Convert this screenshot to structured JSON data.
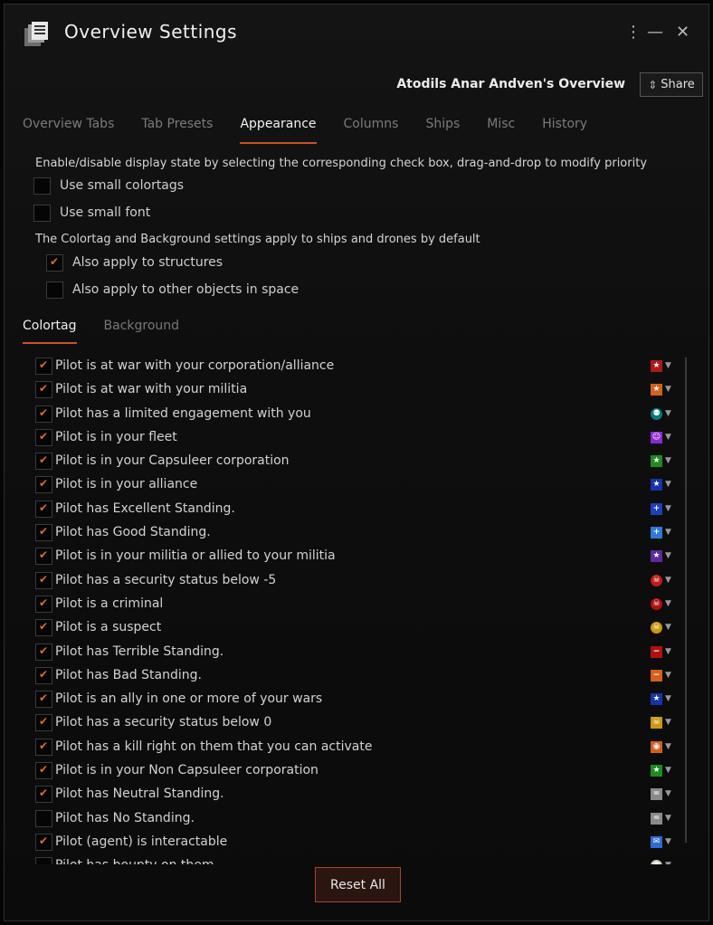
{
  "window": {
    "title": "Overview Settings",
    "owner": "Atodils Anar Andven's Overview",
    "share_label": "Share",
    "menu_icon": "⋮",
    "minimize_icon": "—",
    "close_icon": "✕"
  },
  "tabs": [
    {
      "label": "Overview Tabs",
      "active": false
    },
    {
      "label": "Tab Presets",
      "active": false
    },
    {
      "label": "Appearance",
      "active": true
    },
    {
      "label": "Columns",
      "active": false
    },
    {
      "label": "Ships",
      "active": false
    },
    {
      "label": "Misc",
      "active": false
    },
    {
      "label": "History",
      "active": false
    }
  ],
  "appearance": {
    "intro": "Enable/disable display state by selecting the corresponding check box, drag-and-drop to modify priority",
    "small_colortags": {
      "label": "Use small colortags",
      "checked": false
    },
    "small_font": {
      "label": "Use small font",
      "checked": false
    },
    "apply_note": "The Colortag and Background settings apply to ships and drones by default",
    "apply_structures": {
      "label": "Also apply to structures",
      "checked": true
    },
    "apply_other": {
      "label": "Also apply to other objects in space",
      "checked": false
    }
  },
  "subtabs": [
    {
      "label": "Colortag",
      "active": true
    },
    {
      "label": "Background",
      "active": false
    }
  ],
  "colortags": [
    {
      "label": "Pilot is at war with your corporation/alliance",
      "checked": true,
      "color": "#b01818",
      "symbol": "★",
      "round": false
    },
    {
      "label": "Pilot is at war with your militia",
      "checked": true,
      "color": "#d4601c",
      "symbol": "★",
      "round": false
    },
    {
      "label": "Pilot has a limited engagement with you",
      "checked": true,
      "color": "#0a7a7a",
      "symbol": "⚉",
      "round": true
    },
    {
      "label": "Pilot is in your fleet",
      "checked": true,
      "color": "#8a2bd0",
      "symbol": "☺",
      "round": false
    },
    {
      "label": "Pilot is in your Capsuleer corporation",
      "checked": true,
      "color": "#1f8a22",
      "symbol": "★",
      "round": false
    },
    {
      "label": "Pilot is in your alliance",
      "checked": true,
      "color": "#1633a8",
      "symbol": "★",
      "round": false
    },
    {
      "label": "Pilot has Excellent Standing.",
      "checked": true,
      "color": "#1d3fb8",
      "symbol": "+",
      "round": false
    },
    {
      "label": "Pilot has Good Standing.",
      "checked": true,
      "color": "#2e7ad8",
      "symbol": "+",
      "round": false
    },
    {
      "label": "Pilot is in your militia or allied to your militia",
      "checked": true,
      "color": "#5a2aa0",
      "symbol": "★",
      "round": false
    },
    {
      "label": "Pilot has a security status below -5",
      "checked": true,
      "color": "#c01a1a",
      "symbol": "☠",
      "round": true
    },
    {
      "label": "Pilot is a criminal",
      "checked": true,
      "color": "#b01010",
      "symbol": "☠",
      "round": true
    },
    {
      "label": "Pilot is a suspect",
      "checked": true,
      "color": "#c99a10",
      "symbol": "☠",
      "round": true
    },
    {
      "label": "Pilot has Terrible Standing.",
      "checked": true,
      "color": "#b01010",
      "symbol": "−",
      "round": false
    },
    {
      "label": "Pilot has Bad Standing.",
      "checked": true,
      "color": "#d4601c",
      "symbol": "−",
      "round": false
    },
    {
      "label": "Pilot is an ally in one or more of your wars",
      "checked": true,
      "color": "#1633a8",
      "symbol": "★",
      "round": false
    },
    {
      "label": "Pilot has a security status below 0",
      "checked": true,
      "color": "#c99a10",
      "symbol": "☠",
      "round": false
    },
    {
      "label": "Pilot has a kill right on them that you can activate",
      "checked": true,
      "color": "#d4601c",
      "symbol": "◉",
      "round": false
    },
    {
      "label": "Pilot is in your Non Capsuleer corporation",
      "checked": true,
      "color": "#1f8a22",
      "symbol": "★",
      "round": false
    },
    {
      "label": "Pilot has Neutral Standing.",
      "checked": true,
      "color": "#8a8a8a",
      "symbol": "=",
      "round": false
    },
    {
      "label": "Pilot has No Standing.",
      "checked": false,
      "color": "#8a8a8a",
      "symbol": "=",
      "round": false
    },
    {
      "label": "Pilot (agent) is interactable",
      "checked": true,
      "color": "#2e6ad0",
      "symbol": "✉",
      "round": false
    },
    {
      "label": "Pilot has bounty on them",
      "checked": false,
      "color": "#cccccc",
      "symbol": "●",
      "round": true
    }
  ],
  "footer": {
    "reset_label": "Reset All"
  }
}
